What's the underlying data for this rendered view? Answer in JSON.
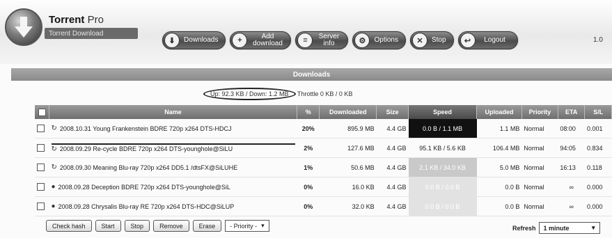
{
  "app": {
    "title": "Torrent",
    "title_suffix": "Pro",
    "tagline": "Torrent Download",
    "version": "1.0"
  },
  "nav": [
    {
      "label": "Downloads",
      "icon": "download-icon",
      "glyph": "⬇"
    },
    {
      "label": "Add download",
      "icon": "add-icon",
      "glyph": "+"
    },
    {
      "label": "Server info",
      "icon": "server-icon",
      "glyph": "≡"
    },
    {
      "label": "Options",
      "icon": "options-icon",
      "glyph": "⚙"
    },
    {
      "label": "Stop",
      "icon": "stop-icon",
      "glyph": "✕"
    },
    {
      "label": "Logout",
      "icon": "logout-icon",
      "glyph": "↩"
    }
  ],
  "downloads": {
    "section_title": "Downloads",
    "stats_updown": "Up: 92.3 KB / Down: 1.2 MB",
    "stats_throttle": "Throttle 0 KB / 0 KB",
    "columns": [
      "Name",
      "%",
      "Downloaded",
      "Size",
      "Speed",
      "Uploaded",
      "Priority",
      "ETA",
      "S/L"
    ],
    "rows": [
      {
        "name": "2008.10.31 Young Frankenstein BDRE 720p x264 DTS-HDCJ",
        "pct": "20%",
        "downloaded": "895.9 MB",
        "size": "4.4 GB",
        "speed": "0.0 B / 1.1 MB",
        "uploaded": "1.1 MB",
        "priority": "Normal",
        "eta": "08:00",
        "sl": "0.001"
      },
      {
        "name": "2008.09.29 Re-cycle BDRE 720p x264 DTS-younghole@SiLU",
        "pct": "2%",
        "downloaded": "127.6 MB",
        "size": "4.4 GB",
        "speed": "95.1 KB / 5.6 KB",
        "uploaded": "106.4 MB",
        "priority": "Normal",
        "eta": "94:05",
        "sl": "0.834"
      },
      {
        "name": "2008.09.30 Meaning Blu-ray 720p x264 DD5.1 /dtsFX@SiLUHE",
        "pct": "1%",
        "downloaded": "50.6 MB",
        "size": "4.4 GB",
        "speed": "2.1 KB / 34.0 KB",
        "uploaded": "5.0 MB",
        "priority": "Normal",
        "eta": "16:13",
        "sl": "0.118"
      },
      {
        "name": "2008.09.28 Deception BDRE 720p x264 DTS-younghole@SiL",
        "pct": "0%",
        "downloaded": "16.0 KB",
        "size": "4.4 GB",
        "speed": "0.0 B / 0.0 B",
        "uploaded": "0.0 B",
        "priority": "Normal",
        "eta": "∞",
        "sl": "0.000"
      },
      {
        "name": "2008.09.28 Chrysalis Blu-ray RE 720p x264 DTS-HDC@SiLUP",
        "pct": "0%",
        "downloaded": "32.0 KB",
        "size": "4.4 GB",
        "speed": "0.0 B / 0.0 B",
        "uploaded": "0.0 B",
        "priority": "Normal",
        "eta": "∞",
        "sl": "0.000"
      }
    ]
  },
  "controls": {
    "check_hash": "Check hash",
    "start": "Start",
    "stop": "Stop",
    "remove": "Remove",
    "erase": "Erase",
    "priority_select": "- Priority -",
    "refresh_label": "Refresh",
    "refresh_value": "1 minute"
  }
}
